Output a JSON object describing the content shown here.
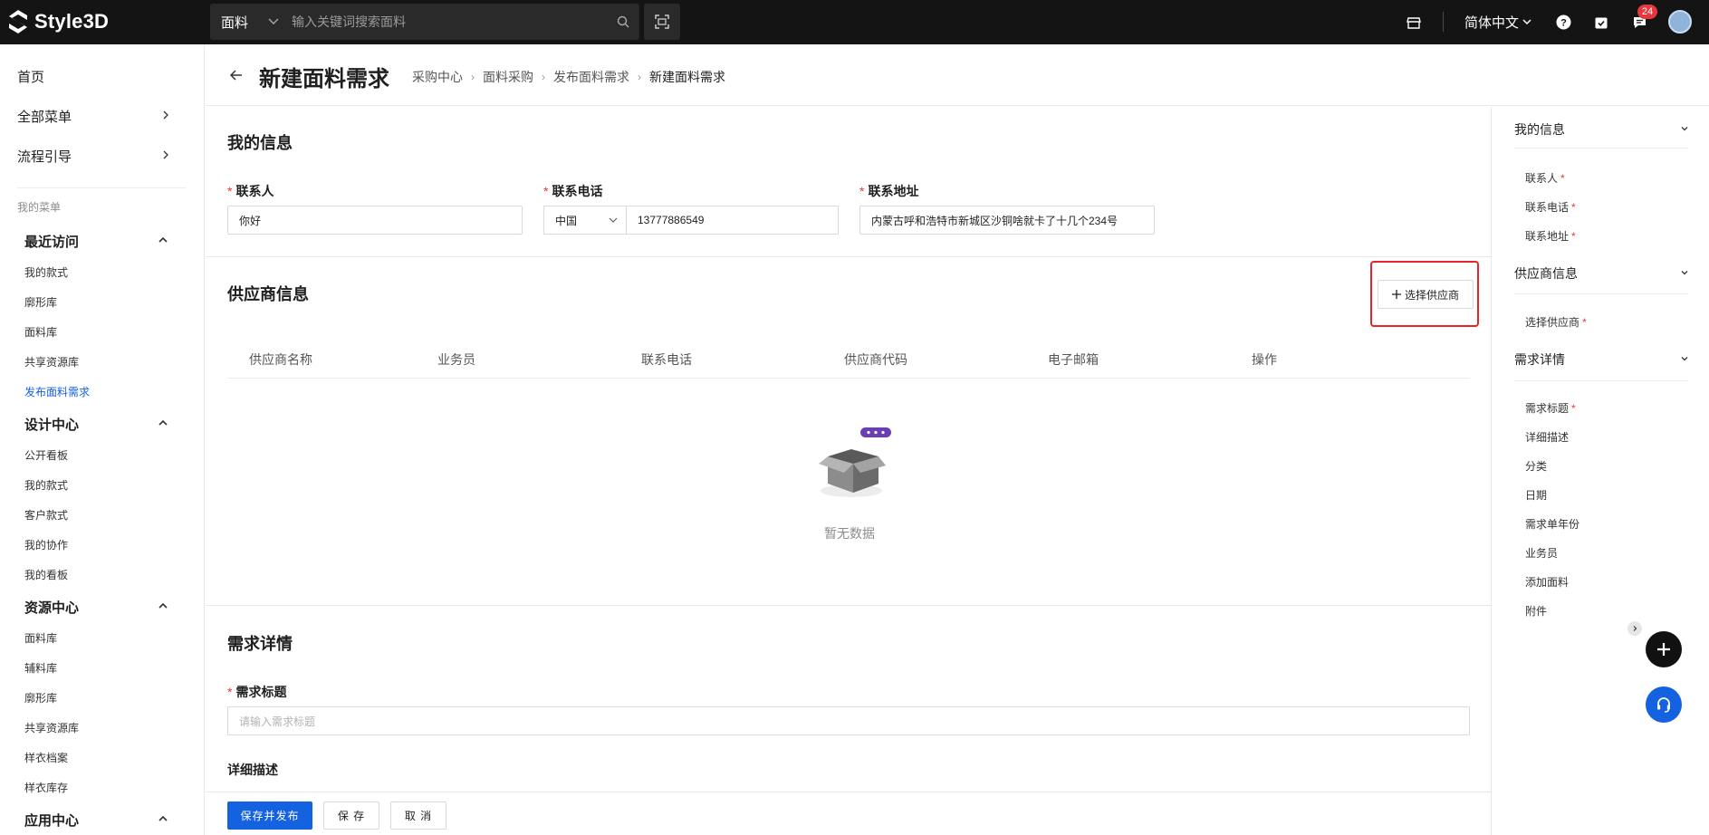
{
  "topbar": {
    "logo_text": "Style3D",
    "search_category": "面料",
    "search_placeholder": "输入关键词搜索面料",
    "language": "简体中文",
    "message_badge": "24",
    "icons": [
      "store-icon",
      "help-icon",
      "task-icon",
      "message-icon",
      "scan-icon",
      "search-icon"
    ]
  },
  "sidebar": {
    "home": "首页",
    "all_menu": "全部菜单",
    "process_guide": "流程引导",
    "my_menu": "我的菜单",
    "groups": [
      {
        "title": "最近访问",
        "items": [
          "我的款式",
          "廓形库",
          "面料库",
          "共享资源库",
          "发布面料需求"
        ]
      },
      {
        "title": "设计中心",
        "items": [
          "公开看板",
          "我的款式",
          "客户款式",
          "我的协作",
          "我的看板"
        ]
      },
      {
        "title": "资源中心",
        "items": [
          "面料库",
          "辅料库",
          "廓形库",
          "共享资源库",
          "样衣档案",
          "样衣库存"
        ]
      },
      {
        "title": "应用中心",
        "items": []
      }
    ],
    "active_item": "发布面料需求"
  },
  "header": {
    "title": "新建面料需求",
    "breadcrumb": [
      "采购中心",
      "面料采购",
      "发布面料需求",
      "新建面料需求"
    ]
  },
  "my_info": {
    "title": "我的信息",
    "contact_label": "联系人",
    "contact_value": "你好",
    "phone_label": "联系电话",
    "phone_country": "中国",
    "phone_value": "13777886549",
    "address_label": "联系地址",
    "address_value": "内蒙古呼和浩特市新城区沙铜啥就卡了十几个234号"
  },
  "supplier": {
    "title": "供应商信息",
    "select_button": "选择供应商",
    "columns": [
      "供应商名称",
      "业务员",
      "联系电话",
      "供应商代码",
      "电子邮箱",
      "操作"
    ],
    "empty_text": "暂无数据"
  },
  "demand": {
    "title": "需求详情",
    "title_label": "需求标题",
    "title_placeholder": "请输入需求标题",
    "desc_label": "详细描述"
  },
  "footer": {
    "publish": "保存并发布",
    "save": "保 存",
    "cancel": "取 消"
  },
  "anchor": {
    "sections": [
      {
        "title": "我的信息",
        "items": [
          {
            "label": "联系人",
            "required": "*"
          },
          {
            "label": "联系电话",
            "required": "*"
          },
          {
            "label": "联系地址",
            "required": "*"
          }
        ]
      },
      {
        "title": "供应商信息",
        "items": [
          {
            "label": "选择供应商",
            "required": "*"
          }
        ]
      },
      {
        "title": "需求详情",
        "items": [
          {
            "label": "需求标题",
            "required": "*"
          },
          {
            "label": "详细描述"
          },
          {
            "label": "分类"
          },
          {
            "label": "日期"
          },
          {
            "label": "需求单年份"
          },
          {
            "label": "业务员"
          },
          {
            "label": "添加面料"
          },
          {
            "label": "附件"
          }
        ]
      }
    ]
  },
  "colors": {
    "primary": "#1462e0",
    "required": "#e8363d",
    "topbar": "#141414",
    "highlight": "#e8242a"
  }
}
